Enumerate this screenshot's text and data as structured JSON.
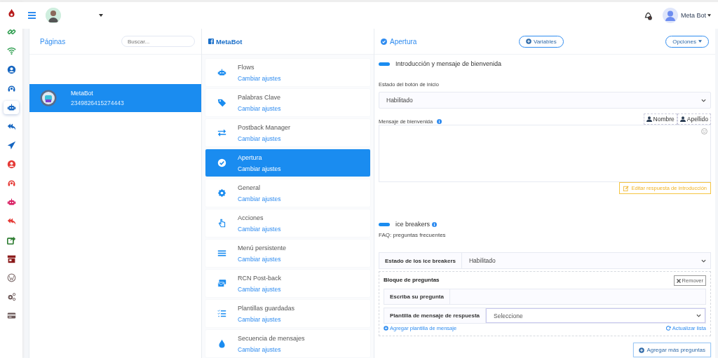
{
  "rail": [
    {
      "kind": "fire",
      "selected": false
    },
    {
      "kind": "link",
      "selected": false
    },
    {
      "kind": "wifi",
      "selected": false
    },
    {
      "kind": "user",
      "selected": false
    },
    {
      "kind": "headset",
      "selected": false
    },
    {
      "kind": "robot",
      "selected": true
    },
    {
      "kind": "reply",
      "selected": false
    },
    {
      "kind": "send",
      "selected": false
    },
    {
      "kind": "user2",
      "selected": false
    },
    {
      "kind": "headset2",
      "selected": false
    },
    {
      "kind": "robot2",
      "selected": false
    },
    {
      "kind": "reply2",
      "selected": false
    },
    {
      "kind": "share",
      "selected": false
    },
    {
      "kind": "store",
      "selected": false
    },
    {
      "kind": "wordpress",
      "selected": false
    },
    {
      "kind": "gears",
      "selected": false
    },
    {
      "kind": "card",
      "selected": false
    }
  ],
  "topbar": {
    "user": "Meta Bot"
  },
  "pages": {
    "title": "Páginas",
    "search": {
      "placeholder": "Buscar..."
    },
    "items": [
      {
        "name": "MetaBot",
        "id": "2349826415274443",
        "selected": true
      }
    ]
  },
  "menu": {
    "title": "MetaBot",
    "items": [
      {
        "kind": "robot",
        "title": "Flows",
        "link": "Cambiar ajustes",
        "selected": false
      },
      {
        "kind": "tag",
        "title": "Palabras Clave",
        "link": "Cambiar ajustes",
        "selected": false
      },
      {
        "kind": "exchange",
        "title": "Postback Manager",
        "link": "Cambiar ajustes",
        "selected": false
      },
      {
        "kind": "check",
        "title": "Apertura",
        "link": "Cambiar ajustes",
        "selected": true
      },
      {
        "kind": "gear",
        "title": "General",
        "link": "Cambiar ajustes",
        "selected": false
      },
      {
        "kind": "hand",
        "title": "Acciones",
        "link": "Cambiar ajustes",
        "selected": false
      },
      {
        "kind": "bars",
        "title": "Menú persistente",
        "link": "Cambiar ajustes",
        "selected": false
      },
      {
        "kind": "envelopes",
        "title": "RCN Post-back",
        "link": "Cambiar ajustes",
        "selected": false
      },
      {
        "kind": "tasks",
        "title": "Plantillas guardadas",
        "link": "Cambiar ajustes",
        "selected": false
      },
      {
        "kind": "drop",
        "title": "Secuencia de mensajes",
        "link": "Cambiar ajustes",
        "selected": false
      }
    ]
  },
  "content": {
    "title": "Apertura",
    "variables_button": "Variables",
    "options_button": "Opciones",
    "intro": {
      "toggle_on": true,
      "heading": "Introducción y mensaje de bienvenida",
      "status_label": "Estado del botón de inicio",
      "status_value": "Habilitado",
      "message_label": "Mensaje de bienvenida",
      "name_button": "Nombre",
      "surname_button": "Apellido",
      "edit_button": "Editar respuesta de introducción"
    },
    "icebreakers": {
      "toggle_on": true,
      "heading": "ice breakers",
      "subtitle": "FAQ: preguntas frecuentes",
      "status_label": "Estado de los ice breakers",
      "status_value": "Habilitado",
      "block": {
        "title": "Bloque de preguntas",
        "remove_button": "Remover",
        "question_label": "Escriba su pregunta",
        "template_label": "Plantilla de mensaje de respuesta",
        "template_placeholder": "Seleccione",
        "add_template_link": "Agregar plantilla de mensaje",
        "refresh_link": "Actualizar lista"
      },
      "add_button": "Agregar más preguntas"
    }
  }
}
